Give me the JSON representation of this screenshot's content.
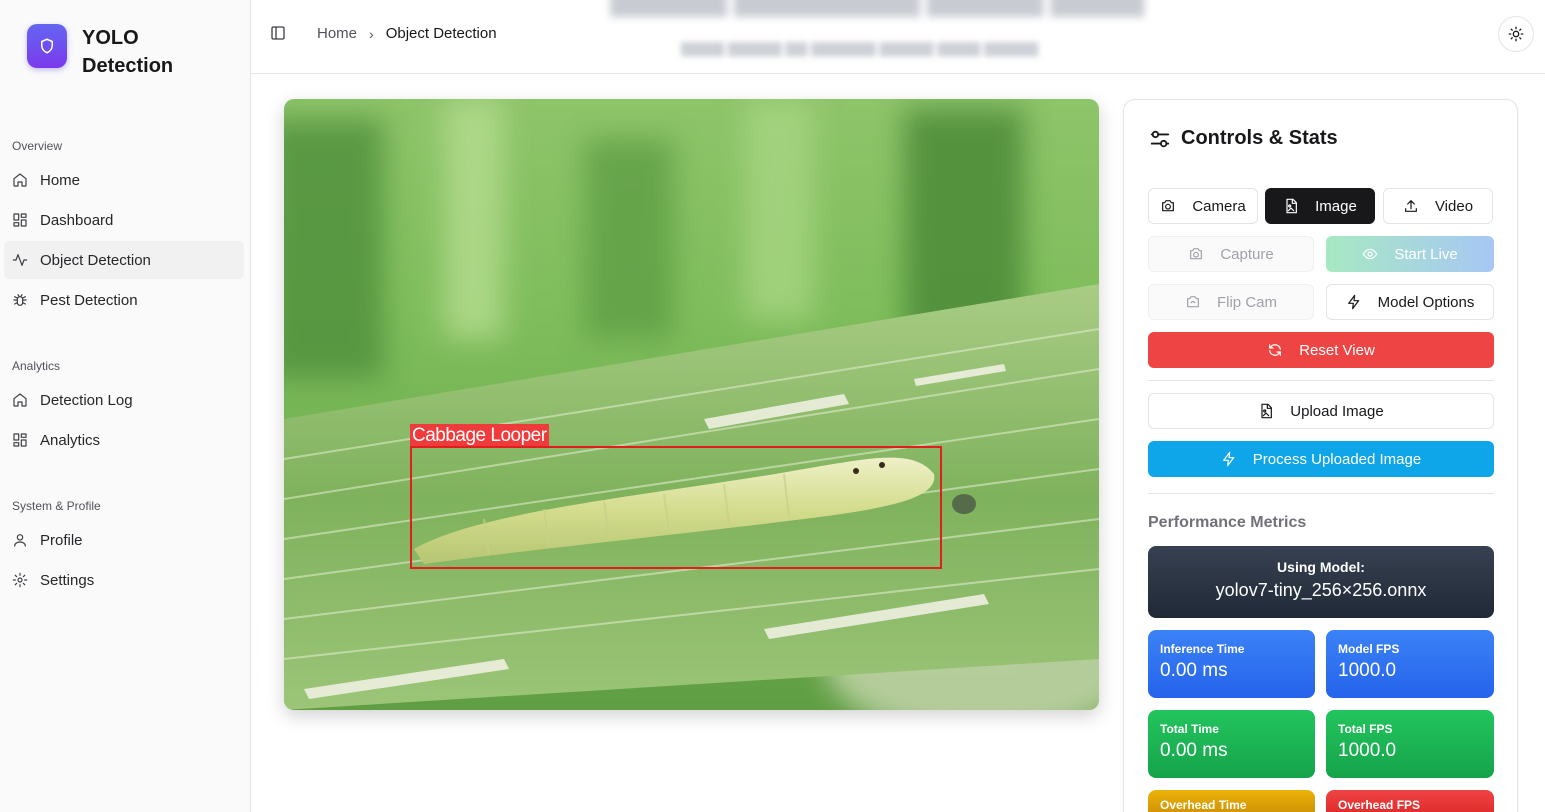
{
  "brand": {
    "title": "YOLO Detection"
  },
  "sidebar": {
    "sections": [
      {
        "title": "Overview",
        "items": [
          {
            "label": "Home",
            "icon": "home-icon"
          },
          {
            "label": "Dashboard",
            "icon": "dashboard-icon"
          },
          {
            "label": "Object Detection",
            "icon": "activity-icon",
            "active": true
          },
          {
            "label": "Pest Detection",
            "icon": "bug-icon"
          }
        ]
      },
      {
        "title": "Analytics",
        "items": [
          {
            "label": "Detection Log",
            "icon": "home-icon"
          },
          {
            "label": "Analytics",
            "icon": "dashboard-icon"
          }
        ]
      },
      {
        "title": "System & Profile",
        "items": [
          {
            "label": "Profile",
            "icon": "user-icon"
          },
          {
            "label": "Settings",
            "icon": "gear-icon"
          }
        ]
      }
    ]
  },
  "header": {
    "breadcrumb": {
      "home": "Home",
      "separator": "›",
      "current": "Object Detection"
    }
  },
  "detection": {
    "label": "Cabbage Looper",
    "box_color": "#e11d1d"
  },
  "controls": {
    "title": "Controls & Stats",
    "camera": "Camera",
    "image": "Image",
    "video": "Video",
    "capture": "Capture",
    "start_live": "Start Live",
    "flip_cam": "Flip Cam",
    "model_options": "Model Options",
    "reset_view": "Reset View",
    "upload_image": "Upload Image",
    "process_uploaded": "Process Uploaded Image"
  },
  "metrics": {
    "section_title": "Performance Metrics",
    "model_label": "Using Model:",
    "model_name": "yolov7-tiny_256×256.onnx",
    "inference_time_label": "Inference Time",
    "inference_time": "0.00 ms",
    "model_fps_label": "Model FPS",
    "model_fps": "1000.0",
    "total_time_label": "Total Time",
    "total_time": "0.00 ms",
    "total_fps_label": "Total FPS",
    "total_fps": "1000.0",
    "overhead_time_label": "Overhead Time",
    "overhead_fps_label": "Overhead FPS"
  },
  "colors": {
    "accent_dark": "#18181b",
    "danger": "#ef4444",
    "info": "#0ea5e9"
  }
}
